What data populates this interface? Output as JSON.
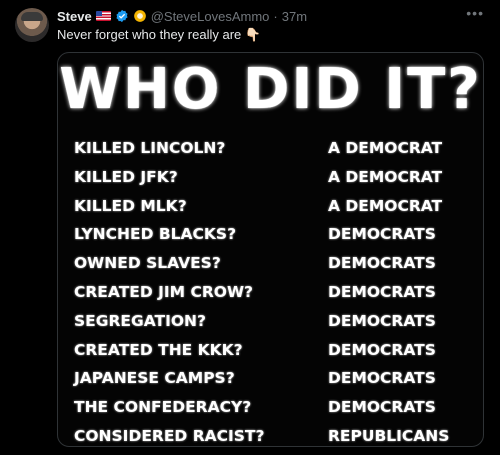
{
  "tweet": {
    "display_name": "Steve",
    "handle": "@SteveLovesAmmo",
    "separator": "·",
    "time": "37m",
    "text": "Never forget who they really are 👇🏻"
  },
  "icons": {
    "flag": "us-flag-icon",
    "verified": "verified-badge-icon",
    "affiliate": "gold-circle-badge-icon",
    "more": "more-icon"
  },
  "colors": {
    "background": "#000000",
    "text": "#e7e9ea",
    "muted": "#71767b",
    "verified": "#1d9bf0",
    "affiliate": "#f4b400"
  },
  "image": {
    "title": "WHO DID IT?",
    "rows": [
      {
        "question": "KILLED LINCOLN?",
        "answer": "A DEMOCRAT"
      },
      {
        "question": "KILLED JFK?",
        "answer": "A DEMOCRAT"
      },
      {
        "question": "KILLED MLK?",
        "answer": "A DEMOCRAT"
      },
      {
        "question": "LYNCHED BLACKS?",
        "answer": "DEMOCRATS"
      },
      {
        "question": "OWNED SLAVES?",
        "answer": "DEMOCRATS"
      },
      {
        "question": "CREATED JIM CROW?",
        "answer": "DEMOCRATS"
      },
      {
        "question": "SEGREGATION?",
        "answer": "DEMOCRATS"
      },
      {
        "question": "CREATED THE KKK?",
        "answer": "DEMOCRATS"
      },
      {
        "question": "JAPANESE CAMPS?",
        "answer": "DEMOCRATS"
      },
      {
        "question": "THE CONFEDERACY?",
        "answer": "DEMOCRATS"
      },
      {
        "question": "CONSIDERED RACIST?",
        "answer": "REPUBLICANS"
      }
    ]
  }
}
